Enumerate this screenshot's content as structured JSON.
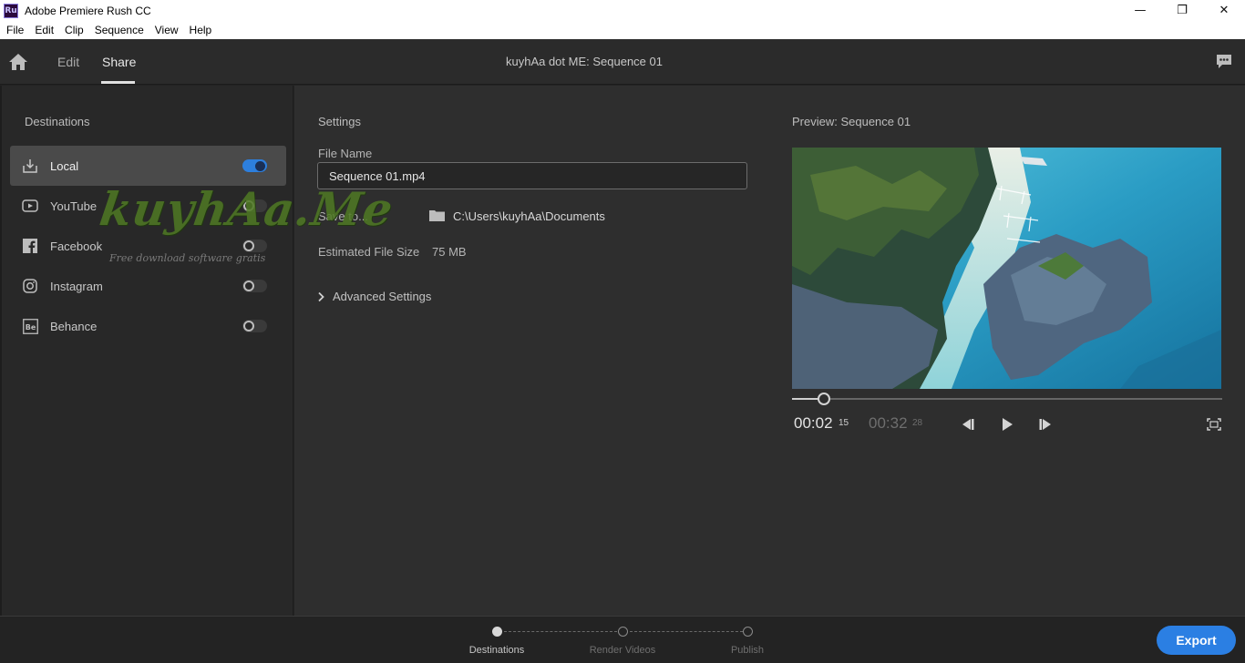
{
  "window": {
    "app_icon_text": "Ru",
    "title": "Adobe Premiere Rush CC",
    "minimize": "—",
    "maximize": "❐",
    "close": "✕"
  },
  "menu": [
    "File",
    "Edit",
    "Clip",
    "Sequence",
    "View",
    "Help"
  ],
  "header": {
    "tabs": [
      {
        "label": "Edit",
        "active": false
      },
      {
        "label": "Share",
        "active": true
      }
    ],
    "sequence_title": "kuyhAa dot ME: Sequence 01"
  },
  "destinations": {
    "heading": "Destinations",
    "items": [
      {
        "label": "Local",
        "icon": "download-icon",
        "enabled": true,
        "selected": true
      },
      {
        "label": "YouTube",
        "icon": "youtube-icon",
        "enabled": false,
        "selected": false
      },
      {
        "label": "Facebook",
        "icon": "facebook-icon",
        "enabled": false,
        "selected": false
      },
      {
        "label": "Instagram",
        "icon": "instagram-icon",
        "enabled": false,
        "selected": false
      },
      {
        "label": "Behance",
        "icon": "behance-icon",
        "enabled": false,
        "selected": false
      }
    ]
  },
  "watermark": {
    "text": "kuyhAa.Me",
    "subtitle": "Free download software gratis"
  },
  "settings": {
    "heading": "Settings",
    "file_name_label": "File Name",
    "file_name_value": "Sequence 01.mp4",
    "save_to_label": "Save to...",
    "save_to_path": "C:\\Users\\kuyhAa\\Documents",
    "estimated_size_label": "Estimated File Size",
    "estimated_size_value": "75 MB",
    "advanced_label": "Advanced Settings"
  },
  "preview": {
    "heading": "Preview: Sequence 01",
    "current_time": "00:02",
    "current_frames": "15",
    "total_time": "00:32",
    "total_frames": "28",
    "progress_fraction": 0.074
  },
  "steps": [
    {
      "label": "Destinations",
      "state": "done"
    },
    {
      "label": "Render Videos",
      "state": "todo"
    },
    {
      "label": "Publish",
      "state": "todo"
    }
  ],
  "export_label": "Export",
  "colors": {
    "accent": "#2b7fe3",
    "panel_dark": "#282828",
    "panel": "#2e2e2e"
  }
}
